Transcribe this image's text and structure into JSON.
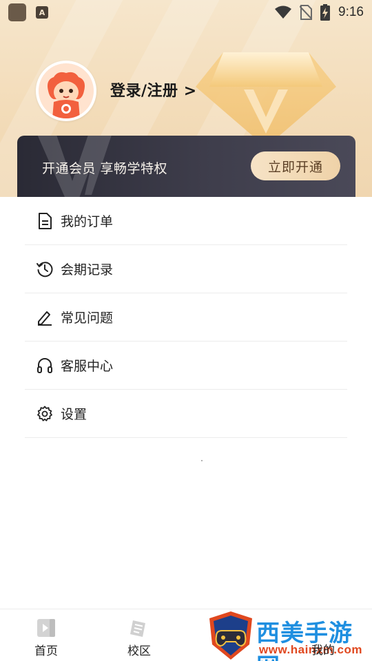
{
  "status_bar": {
    "time": "9:16",
    "notification_letter": "A"
  },
  "profile": {
    "login_label": "登录/注册 >"
  },
  "vip": {
    "text": "开通会员 享畅学特权",
    "button_label": "立即开通"
  },
  "menu": {
    "items": [
      {
        "label": "我的订单",
        "icon": "document-icon"
      },
      {
        "label": "会期记录",
        "icon": "history-icon"
      },
      {
        "label": "常见问题",
        "icon": "edit-icon"
      },
      {
        "label": "客服中心",
        "icon": "headset-icon"
      },
      {
        "label": "设置",
        "icon": "gear-icon"
      }
    ]
  },
  "bottom_nav": {
    "items": [
      {
        "label": "首页",
        "icon": "home-icon"
      },
      {
        "label": "校区",
        "icon": "campus-icon"
      },
      {
        "label": "我的",
        "icon": "profile-icon"
      }
    ]
  },
  "watermark": {
    "text": "西美手游网",
    "url": "www.hainxm.com"
  },
  "colors": {
    "header_bg": "#f3dcb9",
    "vip_bg": "#3e3d4b",
    "vip_button_bg": "#f6e3c6",
    "watermark_blue": "#1f8fe0",
    "watermark_orange": "#e0481f"
  }
}
